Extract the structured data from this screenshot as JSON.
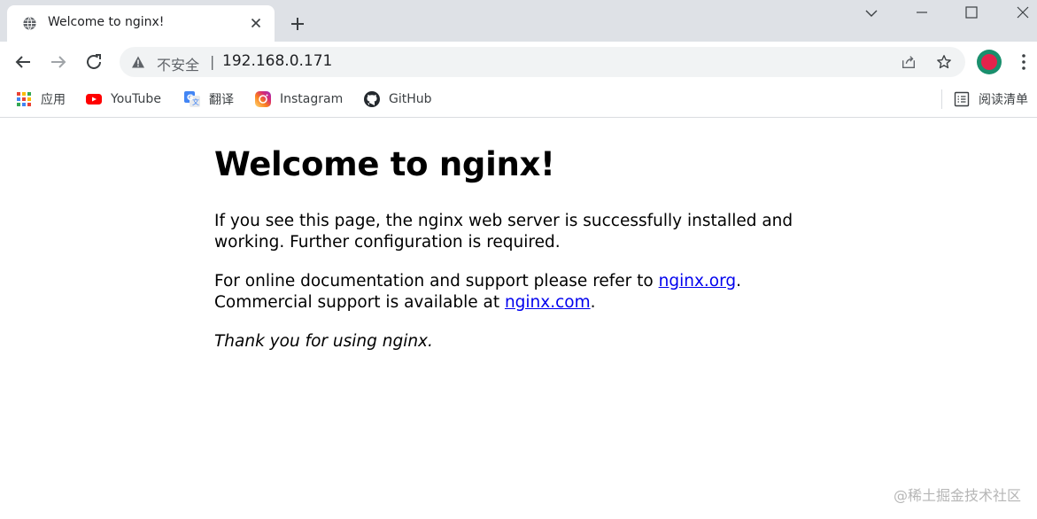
{
  "tab": {
    "title": "Welcome to nginx!"
  },
  "toolbar": {
    "security_label": "不安全",
    "separator": "|",
    "url": "192.168.0.171"
  },
  "bookmarks": [
    {
      "label": "应用",
      "icon": "apps-grid-icon"
    },
    {
      "label": "YouTube",
      "icon": "youtube-icon"
    },
    {
      "label": "翻译",
      "icon": "translate-icon"
    },
    {
      "label": "Instagram",
      "icon": "instagram-icon"
    },
    {
      "label": "GitHub",
      "icon": "github-icon"
    }
  ],
  "reading_list": {
    "label": "阅读清单"
  },
  "page": {
    "heading": "Welcome to nginx!",
    "p1": "If you see this page, the nginx web server is successfully installed and working. Further configuration is required.",
    "p2_prefix": "For online documentation and support please refer to ",
    "p2_link1": "nginx.org",
    "p2_mid": ".",
    "p2_line2_prefix": "Commercial support is available at ",
    "p2_link2": "nginx.com",
    "p2_suffix": ".",
    "p3": "Thank you for using nginx."
  },
  "watermark": "@稀土掘金技术社区",
  "colors": {
    "tabstrip": "#dee1e6",
    "omnibox": "#f1f3f4",
    "link": "#0000ee",
    "avatar_ring": "#1a8f6d",
    "avatar_center": "#e5224b"
  }
}
